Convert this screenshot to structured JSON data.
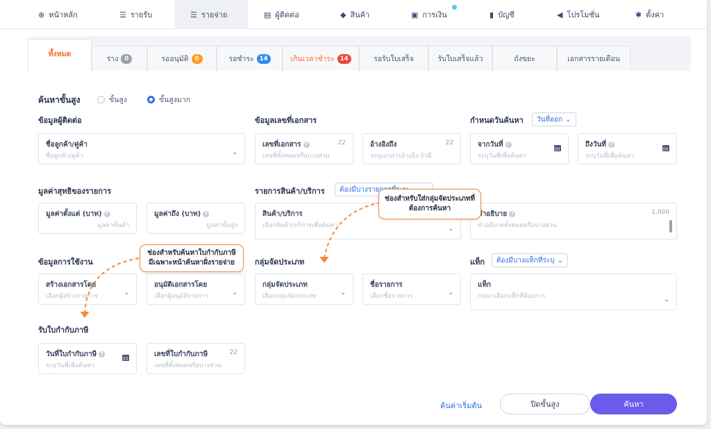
{
  "nav": [
    {
      "label": "หน้าหลัก",
      "icon": "home-icon"
    },
    {
      "label": "รายรับ",
      "icon": "income-list-icon"
    },
    {
      "label": "รายจ่าย",
      "icon": "expense-list-icon",
      "active": true
    },
    {
      "label": "ผู้ติดต่อ",
      "icon": "contacts-icon"
    },
    {
      "label": "สินค้า",
      "icon": "box-icon"
    },
    {
      "label": "การเงิน",
      "icon": "money-icon"
    },
    {
      "label": "บัญชี",
      "icon": "ledger-icon"
    },
    {
      "label": "โปรโมชั่น",
      "icon": "megaphone-icon"
    },
    {
      "label": "ตั้งค่า",
      "icon": "gear-icon"
    }
  ],
  "tabs": [
    {
      "label": "ทั้งหมด",
      "active": true
    },
    {
      "label": "ร่าง",
      "badge": "0",
      "badge_color": "#9aa0ad"
    },
    {
      "label": "รออนุมัติ",
      "badge": "0",
      "badge_color": "#ff9a1f"
    },
    {
      "label": "รอชำระ",
      "badge": "14",
      "badge_color": "#2f8cf0"
    },
    {
      "label": "เกินเวลาชำระ",
      "badge": "14",
      "badge_color": "#f0453a",
      "overdue": true
    },
    {
      "label": "รอรับใบเสร็จ"
    },
    {
      "label": "รับใบเสร็จแล้ว"
    },
    {
      "label": "ถังขยะ"
    },
    {
      "label": "เอกสารรายเดือน"
    }
  ],
  "search": {
    "title": "ค้นหาขั้นสูง",
    "mode_advanced": "ขั้นสูง",
    "mode_super": "ขั้นสูงมาก"
  },
  "sections": {
    "contact": "ข้อมูลผู้ติดต่อ",
    "doc_number": "ข้อมูลเลขที่เอกสาร",
    "date_range": "กำหนดวันค้นหา",
    "net_value": "มูลค่าสุทธิของรายการ",
    "items": "รายการสินค้า/บริการ",
    "usage": "ข้อมูลการใช้งาน",
    "category_group": "กลุ่มจัดประเภท",
    "tags": "แท็ก",
    "tax_invoice": "รับใบกำกับภาษี"
  },
  "selects": {
    "date_type": "วันที่ออก",
    "items_mode": "ต้องมีบางรายการที่ระบุ",
    "tags_mode": "ต้องมีบางแท็กที่ระบุ"
  },
  "fields": {
    "customer": {
      "label": "ชื่อลูกค้า/คู่ค้า",
      "placeholder": "ชื่อลูกค้า/คู่ค้า"
    },
    "doc_no": {
      "label": "เลขที่เอกสาร",
      "placeholder": "เลขที่ทั้งหมดหรือบางส่วน",
      "count": "22"
    },
    "reference": {
      "label": "อ้างอิงถึง",
      "placeholder": "ระบุเอกสารอ้างอิง ถ้ามี",
      "count": "22"
    },
    "from_date": {
      "label": "จากวันที่",
      "placeholder": "ระบุวันที่เพื่อค้นหา"
    },
    "to_date": {
      "label": "ถึงวันที่",
      "placeholder": "ระบุวันที่เพื่อค้นหา"
    },
    "value_from": {
      "label": "มูลค่าตั้งแต่ (บาท)",
      "placeholder": "มูลค่าขั้นต่ำ"
    },
    "value_to": {
      "label": "มูลค่าถึง (บาท)",
      "placeholder": "มูลค่าขั้นสูง"
    },
    "product": {
      "label": "สินค้า/บริการ",
      "placeholder": "เลือกสินค้า/บริการเพื่อค้นหา"
    },
    "description": {
      "label": "คำอธิบาย",
      "placeholder": "คำอธิบายทั้งหมดหรือบางส่วน",
      "count": "1,000"
    },
    "created_by": {
      "label": "สร้างเอกสารโดย",
      "placeholder": "เลือกผู้สร้างรายการ"
    },
    "approved_by": {
      "label": "อนุมัติเอกสารโดย",
      "placeholder": "เลือกผู้อนุมัติรายการ"
    },
    "category_group": {
      "label": "กลุ่มจัดประเภท",
      "placeholder": "เลือกกลุ่มจัดประเภท"
    },
    "item_name": {
      "label": "ชื่อรายการ",
      "placeholder": "เลือกชื่อรายการ"
    },
    "tags": {
      "label": "แท็ก",
      "placeholder": "กรุณาเลือกแท็กที่ต้องการ"
    },
    "tax_date": {
      "label": "วันที่ใบกำกับภาษี",
      "placeholder": "ระบุวันที่เพื่อค้นหา"
    },
    "tax_no": {
      "label": "เลขที่ใบกำกับภาษี",
      "placeholder": "เลขที่ทั้งหมดหรือบางส่วน",
      "count": "22"
    }
  },
  "callouts": {
    "category": [
      "ช่องสำหรับใส่กลุ่มจัดประเภทที่",
      "ต้องการค้นหา"
    ],
    "tax_invoice": [
      "ช่องสำหรับค้นหาใบกำกับภาษี",
      "มีเฉพาะหน้าค้นหาฝั่งรายจ่าย"
    ]
  },
  "actions": {
    "reset": "ค้นค่าเริ่มต้น",
    "close": "ปิดขั้นสูง",
    "search": "ค้นหา"
  },
  "colors": {
    "accent": "#6b5bea",
    "active_tab": "#ff6a2c",
    "link": "#2f6ee8",
    "callout_border": "#f08a3c"
  }
}
